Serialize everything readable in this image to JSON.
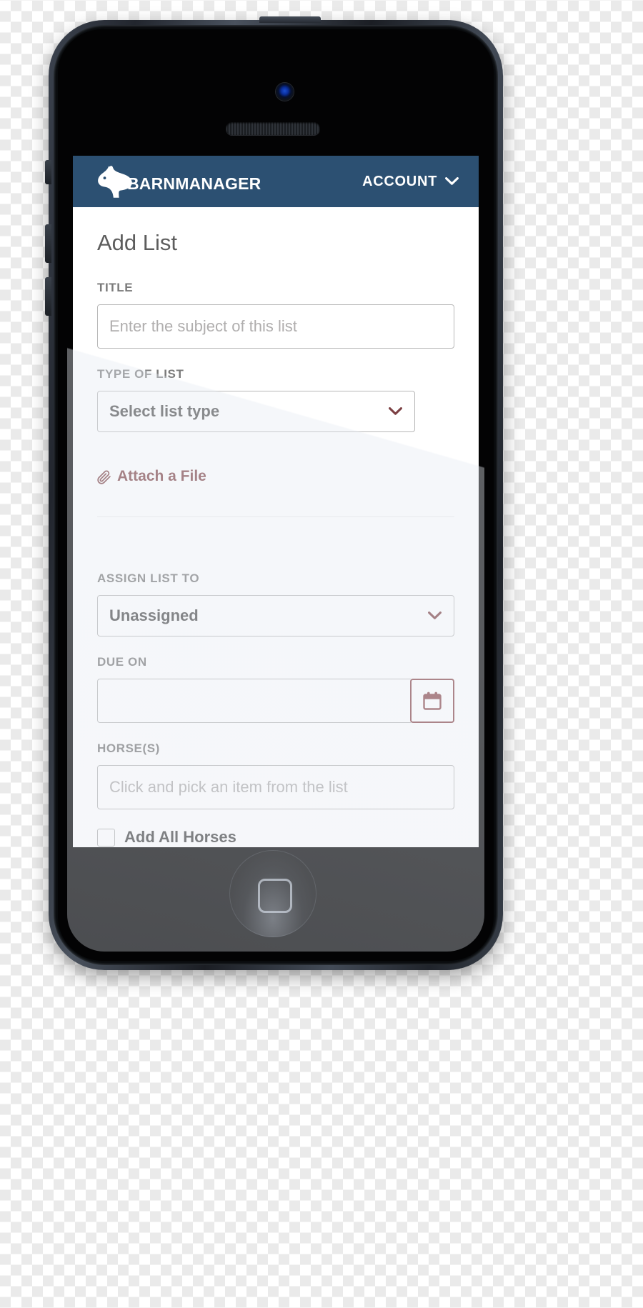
{
  "app": {
    "brand_name": "BARNMANAGER",
    "brand_prefix": "BARN",
    "brand_suffix": "MANAGER",
    "header_color": "#2c5072",
    "accent_color": "#7c4043",
    "account_label": "ACCOUNT",
    "horse_logo_icon": "horse-head-icon",
    "chevron_icon": "chevron-down-icon"
  },
  "page": {
    "title": "Add List"
  },
  "form": {
    "title_field": {
      "label": "TITLE",
      "placeholder": "Enter the subject of this list",
      "value": ""
    },
    "type_field": {
      "label": "TYPE OF LIST",
      "selected": "Select list type",
      "chevron_icon": "chevron-down-icon"
    },
    "attach": {
      "label": "Attach a File",
      "icon": "paperclip-icon"
    },
    "assign_field": {
      "label": "ASSIGN LIST TO",
      "selected": "Unassigned",
      "chevron_icon": "chevron-down-icon"
    },
    "due_field": {
      "label": "DUE ON",
      "value": "",
      "placeholder": "",
      "icon": "calendar-icon"
    },
    "horses_field": {
      "label": "HORSE(S)",
      "placeholder": "Click and pick an item from the list",
      "value": ""
    },
    "add_all_horses": {
      "label": "Add All Horses",
      "checked": false
    }
  },
  "device": {
    "type": "smartphone-mockup",
    "camera_icon": "front-camera",
    "speaker_icon": "earpiece-speaker",
    "home_button_icon": "home-button"
  }
}
